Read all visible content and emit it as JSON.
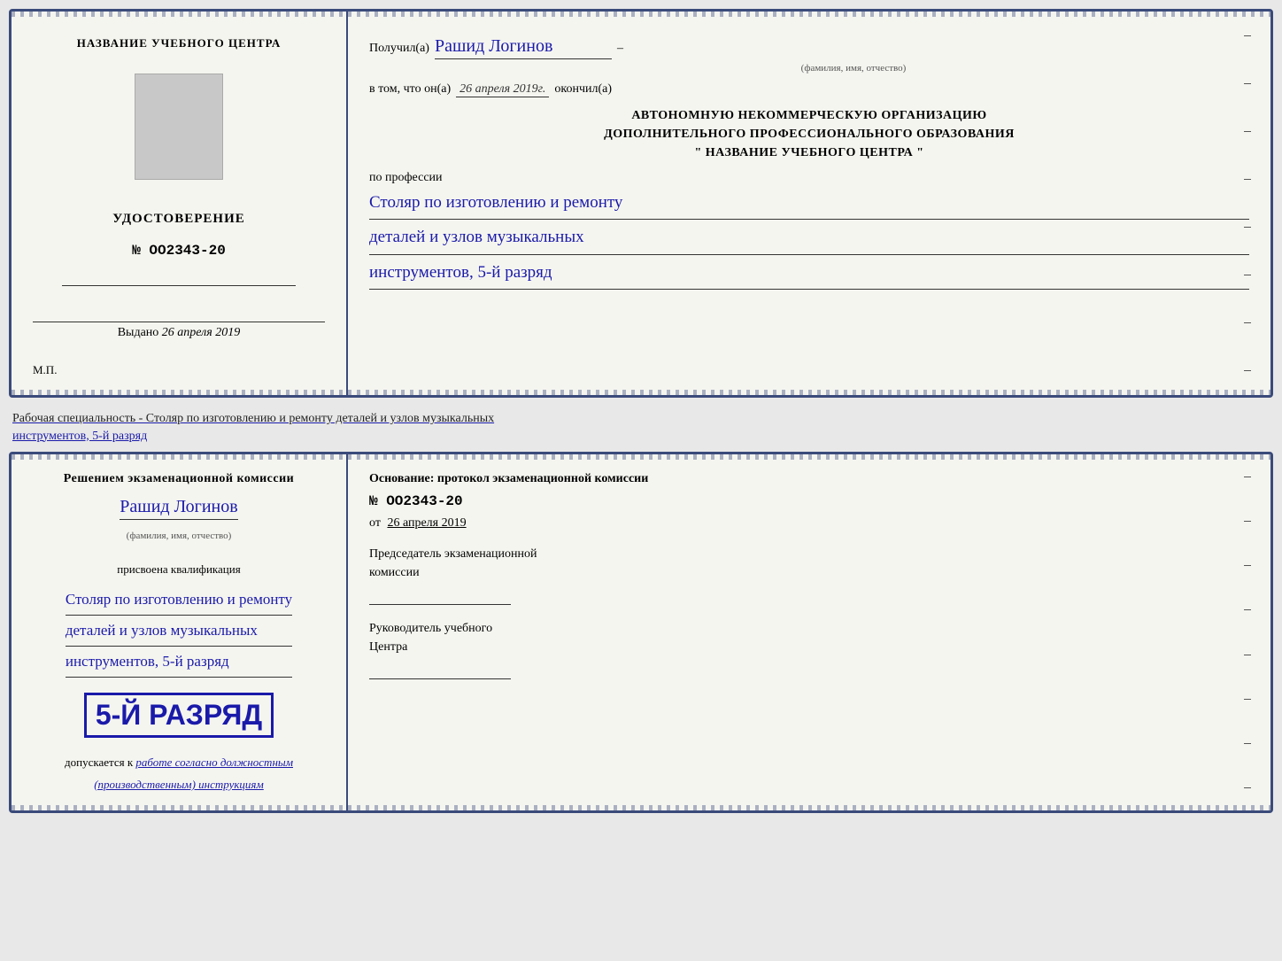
{
  "top_document": {
    "left": {
      "center_name": "НАЗВАНИЕ УЧЕБНОГО ЦЕНТРА",
      "udostoverenie": "УДОСТОВЕРЕНИЕ",
      "number": "№ OO2343-20",
      "vydano_prefix": "Выдано",
      "vydano_date": "26 апреля 2019",
      "mp": "М.П."
    },
    "right": {
      "recipient_prefix": "Получил(а)",
      "recipient_name": "Рашид Логинов",
      "fio_subtitle": "(фамилия, имя, отчество)",
      "vtom_prefix": "в том, что он(а)",
      "vtom_date": "26 апреля 2019г.",
      "okончил": "окончил(а)",
      "org_line1": "АВТОНОМНУЮ НЕКОММЕРЧЕСКУЮ ОРГАНИЗАЦИЮ",
      "org_line2": "ДОПОЛНИТЕЛЬНОГО ПРОФЕССИОНАЛЬНОГО ОБРАЗОВАНИЯ",
      "org_line3": "\"   НАЗВАНИЕ УЧЕБНОГО ЦЕНТРА   \"",
      "po_professii": "по профессии",
      "profession_line1": "Столяр по изготовлению и ремонту",
      "profession_line2": "деталей и узлов музыкальных",
      "profession_line3": "инструментов, 5-й разряд"
    }
  },
  "separator": {
    "text_plain": "Рабочая специальность - Столяр по изготовлению и ремонту деталей и узлов музыкальных",
    "text_underlined": "инструментов, 5-й разряд"
  },
  "bottom_document": {
    "left": {
      "resheniem": "Решением экзаменационной комиссии",
      "name": "Рашид Логинов",
      "fio_subtitle": "(фамилия, имя, отчество)",
      "prisvoena": "присвоена квалификация",
      "qual_line1": "Столяр по изготовлению и ремонту",
      "qual_line2": "деталей и узлов музыкальных",
      "qual_line3": "инструментов, 5-й разряд",
      "big_razryad": "5-й разряд",
      "dopuskaetsya": "допускается к",
      "dopuskaetsya_hw": "работе согласно должностным",
      "dopuskaetsya_hw2": "(производственным) инструкциям"
    },
    "right": {
      "osnovanie": "Основание: протокол экзаменационной  комиссии",
      "number": "№  OO2343-20",
      "ot_prefix": "от",
      "ot_date": "26 апреля 2019",
      "predsedatel": "Председатель экзаменационной\nкомиссии",
      "rukovoditel": "Руководитель учебного\nЦентра"
    }
  }
}
